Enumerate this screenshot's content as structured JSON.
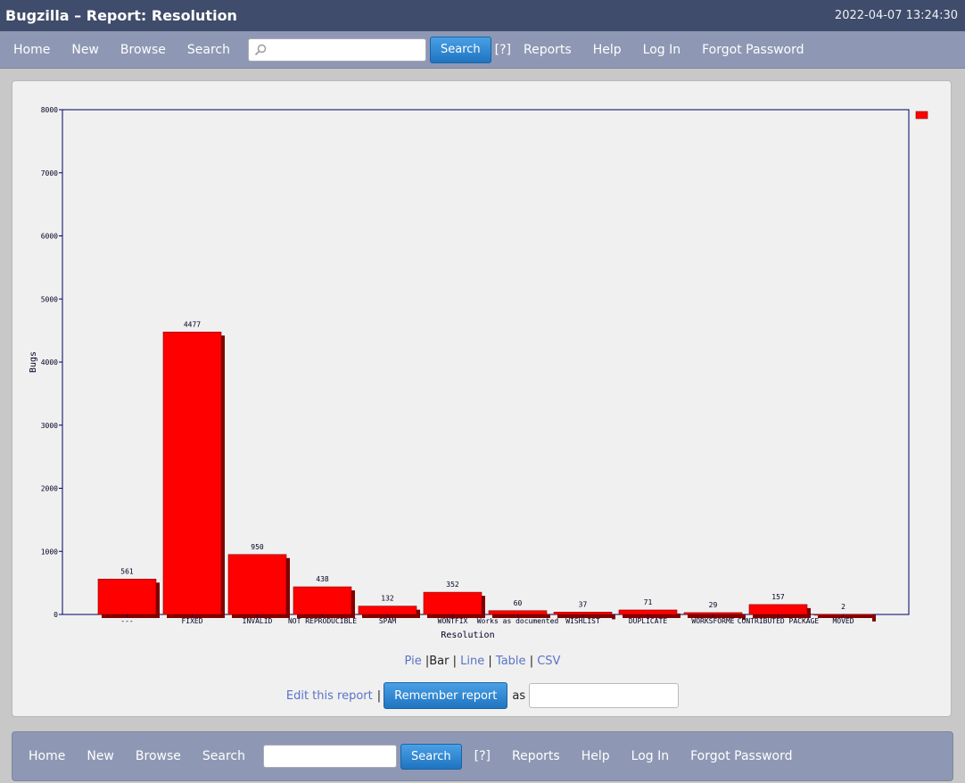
{
  "header": {
    "title": "Bugzilla – Report: Resolution",
    "timestamp": "2022-04-07 13:24:30"
  },
  "nav": {
    "home": "Home",
    "new": "New",
    "browse": "Browse",
    "search": "Search",
    "search_button": "Search",
    "help_q": "[?]",
    "reports": "Reports",
    "help": "Help",
    "login": "Log In",
    "forgot": "Forgot Password",
    "search_value": ""
  },
  "formats": {
    "pie": "Pie",
    "bar": "Bar",
    "line": "Line",
    "table": "Table",
    "csv": "CSV",
    "sep": "|"
  },
  "remember": {
    "edit": "Edit this report",
    "sep": "|",
    "button": "Remember report",
    "as": "as",
    "value": ""
  },
  "colors": {
    "bar": "#ff0000",
    "bar_shadow": "#800000",
    "axis": "#000066"
  },
  "chart_data": {
    "type": "bar",
    "categories": [
      "---",
      "FIXED",
      "INVALID",
      "NOT REPRODUCIBLE",
      "SPAM",
      "WONTFIX",
      "Works as documented",
      "WISHLIST",
      "DUPLICATE",
      "WORKSFORME",
      "CONTRIBUTED PACKAGE",
      "MOVED"
    ],
    "values": [
      561,
      4477,
      950,
      438,
      132,
      352,
      60,
      37,
      71,
      29,
      157,
      2
    ],
    "xlabel": "Resolution",
    "ylabel": "Bugs",
    "ylim": [
      0,
      8000
    ],
    "yticks": [
      0,
      1000,
      2000,
      3000,
      4000,
      5000,
      6000,
      7000,
      8000
    ],
    "grid": false,
    "legend": "top-right",
    "series": [
      {
        "values": [
          561,
          4477,
          950,
          438,
          132,
          352,
          60,
          37,
          71,
          29,
          157,
          2
        ]
      }
    ]
  }
}
